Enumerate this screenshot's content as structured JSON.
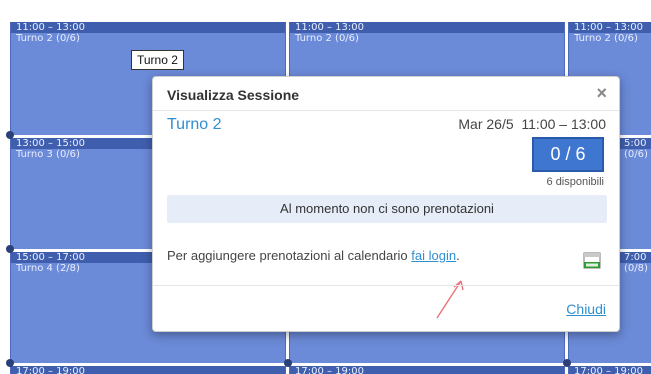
{
  "calendar": {
    "columns": [
      {
        "slots": [
          {
            "time": "11:00 – 13:00",
            "label": "Turno 2 (0/6)"
          },
          {
            "time": "13:00 – 15:00",
            "label": "Turno 3 (0/6)"
          },
          {
            "time": "15:00 – 17:00",
            "label": "Turno 4 (2/8)"
          },
          {
            "time": "17:00 – 19:00",
            "label": ""
          }
        ]
      },
      {
        "slots": [
          {
            "time": "11:00 – 13:00",
            "label": "Turno 2 (0/6)"
          },
          {
            "time": "",
            "label": ""
          },
          {
            "time": "",
            "label": ""
          },
          {
            "time": "17:00 – 19:00",
            "label": ""
          }
        ]
      },
      {
        "slots": [
          {
            "time": "11:00 – 13:00",
            "label": "Turno 2 (0/6)"
          },
          {
            "time": "5:00",
            "label": "(0/6)"
          },
          {
            "time": "7:00",
            "label": "(0/8)"
          },
          {
            "time": "17:00 – 19:00",
            "label": ""
          }
        ]
      }
    ],
    "colors": {
      "event_bg": "#6b8ad8",
      "event_head": "#3f5fae"
    }
  },
  "tooltip": {
    "text": "Turno 2"
  },
  "modal": {
    "title": "Visualizza Sessione",
    "close_icon": "×",
    "session_name": "Turno 2",
    "session_when": "Mar 26/5  11:00 – 13:00",
    "capacity": "0 / 6",
    "available": "6 disponibili",
    "no_bookings": "Al momento non ci sono prenotazioni",
    "login_prefix": "Per aggiungere prenotazioni al calendario ",
    "login_link": "fai login",
    "login_suffix": ".",
    "ical_icon": "ical-calendar-icon",
    "close_label": "Chiudi"
  }
}
